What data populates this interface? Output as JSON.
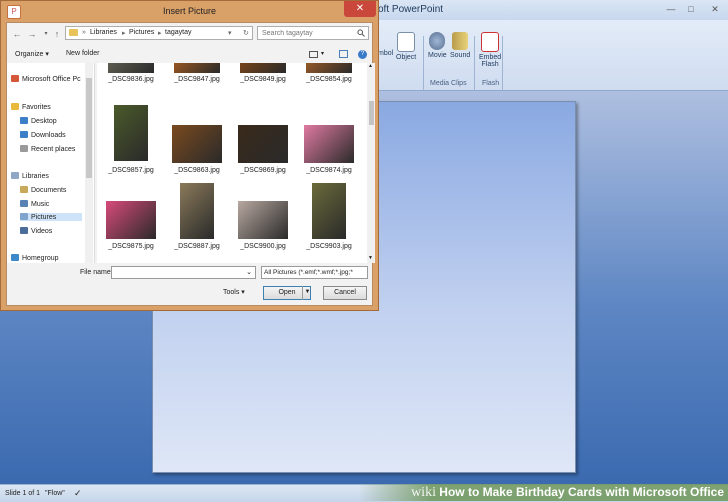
{
  "ppt": {
    "title": "oft PowerPoint",
    "ribbon": {
      "symbol_label": "mbol",
      "object_label": "Object",
      "movie_label": "Movie",
      "sound_label": "Sound",
      "embed_flash_label_1": "Embed",
      "embed_flash_label_2": "Flash",
      "group_media_clips": "Media Clips",
      "group_flash": "Flash"
    },
    "status": {
      "slide_info": "Slide 1 of 1",
      "theme": "\"Flow\""
    }
  },
  "banner": {
    "wiki": "wiki",
    "text": "How to Make Birthday Cards with Microsoft Office"
  },
  "dialog": {
    "title": "Insert Picture",
    "close_glyph": "✕",
    "breadcrumbs": [
      "Libraries",
      "Pictures",
      "tagaytay"
    ],
    "search_placeholder": "Search tagaytay",
    "toolbar": {
      "organize": "Organize ▾",
      "new_folder": "New folder"
    },
    "nav": {
      "office": "Microsoft Office Pc",
      "favorites": "Favorites",
      "desktop": "Desktop",
      "downloads": "Downloads",
      "recent": "Recent places",
      "libraries": "Libraries",
      "documents": "Documents",
      "music": "Music",
      "pictures": "Pictures",
      "videos": "Videos",
      "homegroup": "Homegroup"
    },
    "files": [
      {
        "name": "_DSC9836.jpg",
        "color": "#6b6b5a"
      },
      {
        "name": "_DSC9847.jpg",
        "color": "#b5631e"
      },
      {
        "name": "_DSC9849.jpg",
        "color": "#8a4a14"
      },
      {
        "name": "_DSC9854.jpg",
        "color": "#b26628"
      },
      {
        "name": "_DSC9857.jpg",
        "color": "#4a5a2a"
      },
      {
        "name": "_DSC9863.jpg",
        "color": "#7a4a1e"
      },
      {
        "name": "_DSC9869.jpg",
        "color": "#3a2a1a"
      },
      {
        "name": "_DSC9874.jpg",
        "color": "#e07aa0"
      },
      {
        "name": "_DSC9875.jpg",
        "color": "#d84a7a"
      },
      {
        "name": "_DSC9887.jpg",
        "color": "#8a7a5a"
      },
      {
        "name": "_DSC9900.jpg",
        "color": "#b8a8a0"
      },
      {
        "name": "_DSC9903.jpg",
        "color": "#6a6a3a"
      }
    ],
    "filename_label": "File name:",
    "filename_value": "",
    "filetype": "All Pictures (*.emf;*.wmf;*.jpg;*",
    "tools": "Tools",
    "open": "Open",
    "cancel": "Cancel"
  }
}
